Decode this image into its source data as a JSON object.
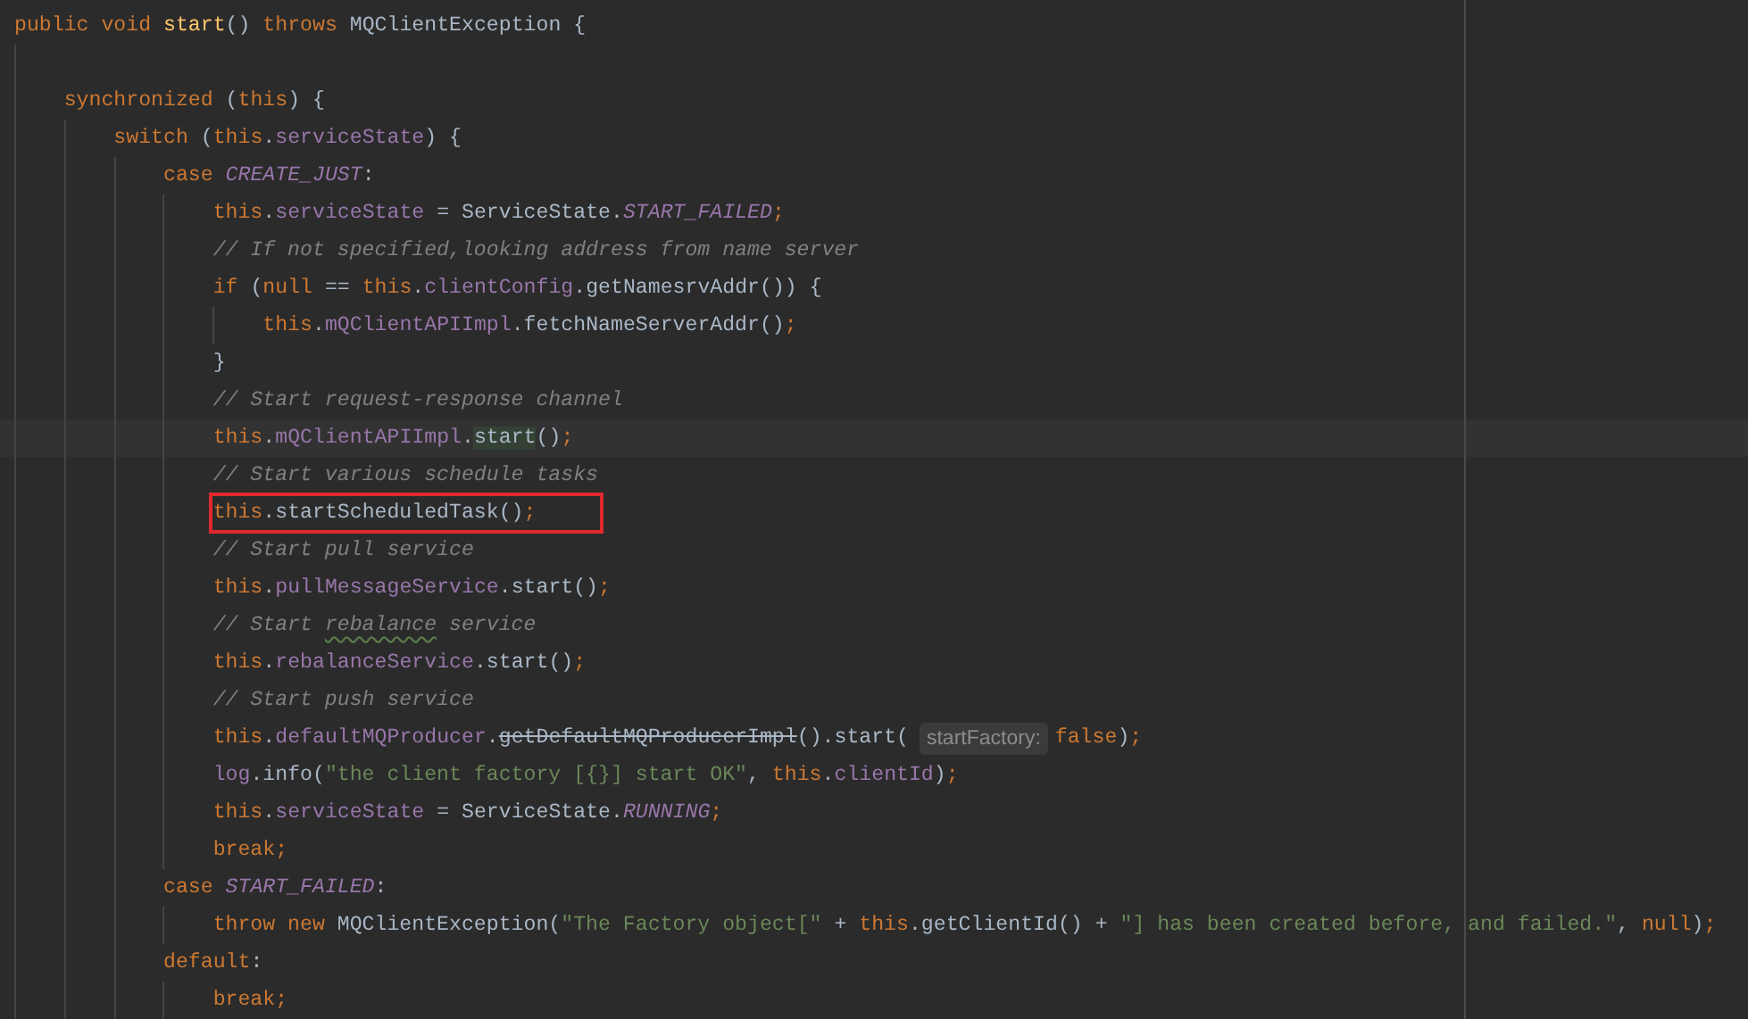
{
  "lines": [
    {
      "tokens": [
        {
          "kind": "keyword",
          "text": "public void "
        },
        {
          "kind": "method_decl",
          "text": "start"
        },
        {
          "kind": "plain",
          "text": "() "
        },
        {
          "kind": "keyword",
          "text": "throws "
        },
        {
          "kind": "plain",
          "text": "MQClientException {"
        }
      ]
    },
    {
      "blank": true
    },
    {
      "tokens": [
        {
          "kind": "keyword",
          "text": "    synchronized "
        },
        {
          "kind": "plain",
          "text": "("
        },
        {
          "kind": "keyword",
          "text": "this"
        },
        {
          "kind": "plain",
          "text": ") {"
        }
      ]
    },
    {
      "tokens": [
        {
          "kind": "keyword",
          "text": "        switch "
        },
        {
          "kind": "plain",
          "text": "("
        },
        {
          "kind": "keyword",
          "text": "this"
        },
        {
          "kind": "plain",
          "text": "."
        },
        {
          "kind": "field",
          "text": "serviceState"
        },
        {
          "kind": "plain",
          "text": ") {"
        }
      ]
    },
    {
      "tokens": [
        {
          "kind": "keyword",
          "text": "            case "
        },
        {
          "kind": "constant",
          "text": "CREATE_JUST"
        },
        {
          "kind": "plain",
          "text": ":"
        }
      ]
    },
    {
      "tokens": [
        {
          "kind": "keyword",
          "text": "                this"
        },
        {
          "kind": "plain",
          "text": "."
        },
        {
          "kind": "field",
          "text": "serviceState"
        },
        {
          "kind": "plain",
          "text": " = ServiceState."
        },
        {
          "kind": "constant",
          "text": "START_FAILED"
        },
        {
          "kind": "keyword",
          "text": ";"
        }
      ]
    },
    {
      "tokens": [
        {
          "kind": "comment",
          "text": "                // If not specified,looking address from name server"
        }
      ]
    },
    {
      "tokens": [
        {
          "kind": "keyword",
          "text": "                if "
        },
        {
          "kind": "plain",
          "text": "("
        },
        {
          "kind": "keyword",
          "text": "null "
        },
        {
          "kind": "plain",
          "text": "== "
        },
        {
          "kind": "keyword",
          "text": "this"
        },
        {
          "kind": "plain",
          "text": "."
        },
        {
          "kind": "field",
          "text": "clientConfig"
        },
        {
          "kind": "plain",
          "text": ".getNamesrvAddr()) {"
        }
      ]
    },
    {
      "tokens": [
        {
          "kind": "keyword",
          "text": "                    this"
        },
        {
          "kind": "plain",
          "text": "."
        },
        {
          "kind": "field",
          "text": "mQClientAPIImpl"
        },
        {
          "kind": "plain",
          "text": ".fetchNameServerAddr()"
        },
        {
          "kind": "keyword",
          "text": ";"
        }
      ]
    },
    {
      "tokens": [
        {
          "kind": "plain",
          "text": "                }"
        }
      ]
    },
    {
      "tokens": [
        {
          "kind": "comment",
          "text": "                // Start request-response channel"
        }
      ]
    },
    {
      "current": true,
      "tokens": [
        {
          "kind": "keyword",
          "text": "                this"
        },
        {
          "kind": "plain",
          "text": "."
        },
        {
          "kind": "field",
          "text": "mQClientAPIImpl"
        },
        {
          "kind": "plain",
          "text": "."
        },
        {
          "kind": "usage",
          "text": "start"
        },
        {
          "kind": "plain",
          "text": "()"
        },
        {
          "kind": "keyword",
          "text": ";"
        }
      ]
    },
    {
      "tokens": [
        {
          "kind": "comment",
          "text": "                // Start various schedule tasks"
        }
      ]
    },
    {
      "boxed": true,
      "tokens": [
        {
          "kind": "keyword",
          "text": "                this"
        },
        {
          "kind": "plain",
          "text": ".startScheduledTask()"
        },
        {
          "kind": "keyword",
          "text": ";"
        }
      ]
    },
    {
      "tokens": [
        {
          "kind": "comment",
          "text": "                // Start pull service"
        }
      ]
    },
    {
      "tokens": [
        {
          "kind": "keyword",
          "text": "                this"
        },
        {
          "kind": "plain",
          "text": "."
        },
        {
          "kind": "field",
          "text": "pullMessageService"
        },
        {
          "kind": "plain",
          "text": ".start()"
        },
        {
          "kind": "keyword",
          "text": ";"
        }
      ]
    },
    {
      "tokens": [
        {
          "kind": "comment",
          "text": "                // Start "
        },
        {
          "kind": "typo",
          "text": "rebalance"
        },
        {
          "kind": "comment",
          "text": " service"
        }
      ]
    },
    {
      "tokens": [
        {
          "kind": "keyword",
          "text": "                this"
        },
        {
          "kind": "plain",
          "text": "."
        },
        {
          "kind": "field",
          "text": "rebalanceService"
        },
        {
          "kind": "plain",
          "text": ".start()"
        },
        {
          "kind": "keyword",
          "text": ";"
        }
      ]
    },
    {
      "tokens": [
        {
          "kind": "comment",
          "text": "                // Start push service"
        }
      ]
    },
    {
      "tokens": [
        {
          "kind": "keyword",
          "text": "                this"
        },
        {
          "kind": "plain",
          "text": "."
        },
        {
          "kind": "field",
          "text": "defaultMQProducer"
        },
        {
          "kind": "plain",
          "text": "."
        },
        {
          "kind": "deprecated",
          "text": "getDefaultMQProducerImpl"
        },
        {
          "kind": "plain",
          "text": "().start("
        },
        {
          "kind": "hint",
          "text": "startFactory:"
        },
        {
          "kind": "keyword",
          "text": "false"
        },
        {
          "kind": "plain",
          "text": ")"
        },
        {
          "kind": "keyword",
          "text": ";"
        }
      ]
    },
    {
      "tokens": [
        {
          "kind": "field",
          "text": "                log"
        },
        {
          "kind": "plain",
          "text": ".info("
        },
        {
          "kind": "string",
          "text": "\"the client factory [{}] start OK\""
        },
        {
          "kind": "plain",
          "text": ", "
        },
        {
          "kind": "keyword",
          "text": "this"
        },
        {
          "kind": "plain",
          "text": "."
        },
        {
          "kind": "field",
          "text": "clientId"
        },
        {
          "kind": "plain",
          "text": ")"
        },
        {
          "kind": "keyword",
          "text": ";"
        }
      ]
    },
    {
      "tokens": [
        {
          "kind": "keyword",
          "text": "                this"
        },
        {
          "kind": "plain",
          "text": "."
        },
        {
          "kind": "field",
          "text": "serviceState"
        },
        {
          "kind": "plain",
          "text": " = ServiceState."
        },
        {
          "kind": "constant",
          "text": "RUNNING"
        },
        {
          "kind": "keyword",
          "text": ";"
        }
      ]
    },
    {
      "tokens": [
        {
          "kind": "keyword",
          "text": "                break;"
        }
      ]
    },
    {
      "tokens": [
        {
          "kind": "keyword",
          "text": "            case "
        },
        {
          "kind": "constant",
          "text": "START_FAILED"
        },
        {
          "kind": "plain",
          "text": ":"
        }
      ]
    },
    {
      "tokens": [
        {
          "kind": "keyword",
          "text": "                throw new "
        },
        {
          "kind": "plain",
          "text": "MQClientException("
        },
        {
          "kind": "string",
          "text": "\"The Factory object[\" "
        },
        {
          "kind": "plain",
          "text": "+ "
        },
        {
          "kind": "keyword",
          "text": "this"
        },
        {
          "kind": "plain",
          "text": ".getClientId() + "
        },
        {
          "kind": "string",
          "text": "\"] has been created before, and failed.\""
        },
        {
          "kind": "plain",
          "text": ", "
        },
        {
          "kind": "keyword",
          "text": "null"
        },
        {
          "kind": "plain",
          "text": ")"
        },
        {
          "kind": "keyword",
          "text": ";"
        }
      ]
    },
    {
      "tokens": [
        {
          "kind": "keyword",
          "text": "            default"
        },
        {
          "kind": "plain",
          "text": ":"
        }
      ]
    },
    {
      "tokens": [
        {
          "kind": "keyword",
          "text": "                break;"
        }
      ]
    }
  ]
}
